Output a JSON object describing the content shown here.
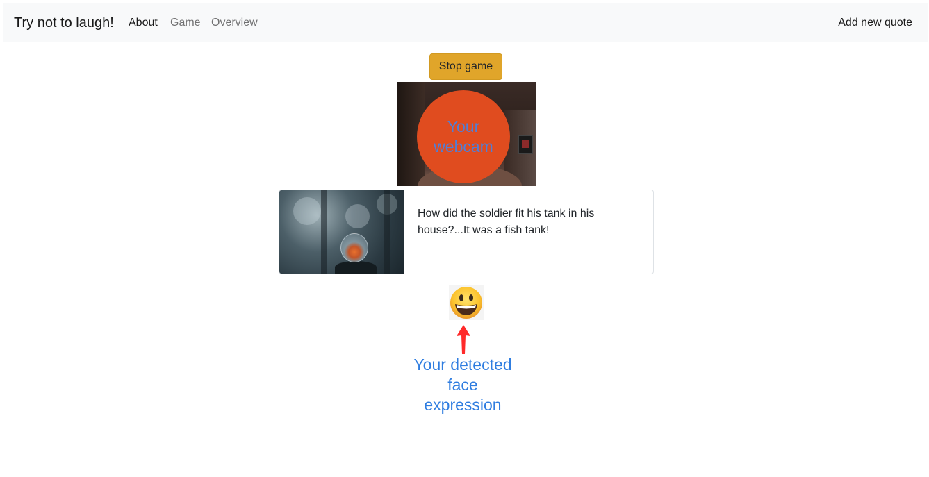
{
  "navbar": {
    "brand": "Try not to laugh!",
    "links": [
      {
        "label": "About",
        "active": true
      },
      {
        "label": "Game",
        "active": false
      },
      {
        "label": "Overview",
        "active": false
      }
    ],
    "right_link": "Add new quote"
  },
  "controls": {
    "stop_label": "Stop game",
    "stop_color": "#e0a52a"
  },
  "webcam": {
    "overlay_label": "Your webcam",
    "overlay_color": "#e04c1f"
  },
  "quote": {
    "text": "How did the soldier fit his tank in his house?...It was a fish tank!",
    "image_icon": "goldfish-bowl-photo"
  },
  "expression": {
    "emoji_icon": "smiling-face-emoji",
    "annotation": "Your detected face expression",
    "arrow_color": "#ff2a2a",
    "annotation_color": "#2f7de0"
  }
}
